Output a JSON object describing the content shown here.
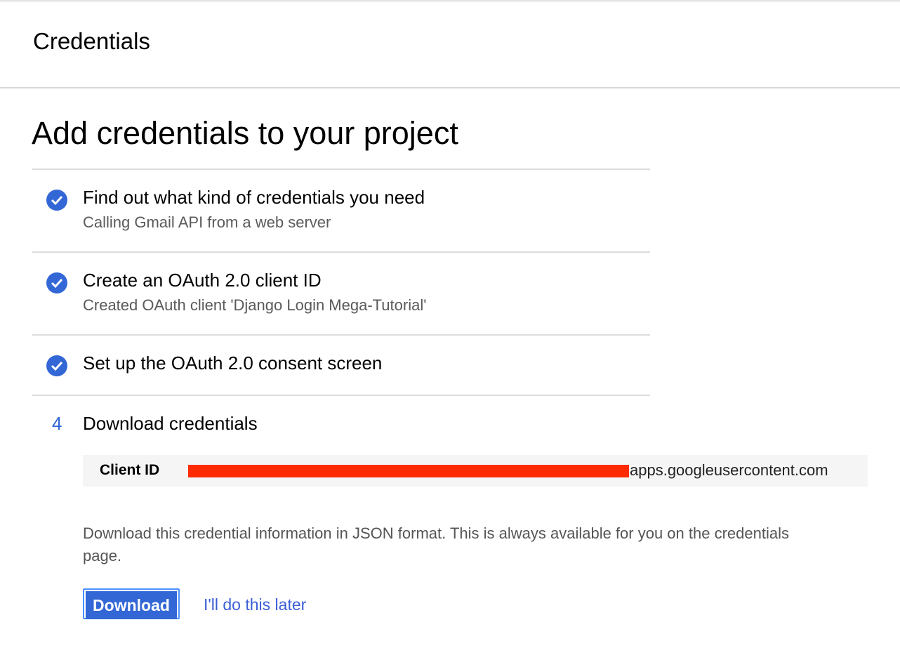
{
  "header": {
    "title": "Credentials"
  },
  "page_title": "Add credentials to your project",
  "steps": [
    {
      "title": "Find out what kind of credentials you need",
      "subtitle": "Calling Gmail API from a web server",
      "status": "complete"
    },
    {
      "title": "Create an OAuth 2.0 client ID",
      "subtitle": "Created OAuth client 'Django Login Mega-Tutorial'",
      "status": "complete"
    },
    {
      "title": "Set up the OAuth 2.0 consent screen",
      "status": "complete"
    },
    {
      "number": "4",
      "title": "Download credentials",
      "status": "current"
    }
  ],
  "client_id": {
    "label": "Client ID",
    "suffix": "apps.googleusercontent.com"
  },
  "description": "Download this credential information in JSON format. This is always available for you on the credentials page.",
  "buttons": {
    "download": "Download",
    "later": "I'll do this later"
  },
  "colors": {
    "accent": "#3367d6",
    "redaction": "#ff2a00"
  }
}
